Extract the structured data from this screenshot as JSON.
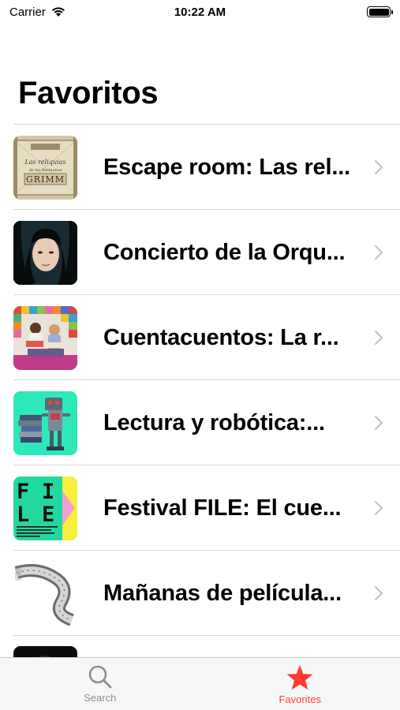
{
  "status_bar": {
    "carrier": "Carrier",
    "time": "10:22 AM"
  },
  "page": {
    "title": "Favoritos"
  },
  "favorites": [
    {
      "title": "Escape room: Las reliquias de los hermanos Grimm",
      "display": "Escape room: Las rel...",
      "thumb_text": "GRIMM"
    },
    {
      "title": "Concierto de la Orquesta",
      "display": "Concierto de la Orqu..."
    },
    {
      "title": "Cuentacuentos: La r",
      "display": "Cuentacuentos: La r..."
    },
    {
      "title": "Lectura y robótica:",
      "display": "Lectura y robótica:..."
    },
    {
      "title": "Festival FILE: El cue",
      "display": "Festival FILE: El cue...",
      "thumb_text": "FILE"
    },
    {
      "title": "Mañanas de película",
      "display": "Mañanas de película..."
    }
  ],
  "tabs": [
    {
      "label": "Search",
      "icon": "search-icon",
      "active": false
    },
    {
      "label": "Favorites",
      "icon": "star-icon",
      "active": true
    }
  ],
  "colors": {
    "accent": "#ff3b30",
    "inactive": "#8e8e93",
    "separator": "#d8d8d8",
    "tab_bar_bg": "#f7f7f7"
  }
}
